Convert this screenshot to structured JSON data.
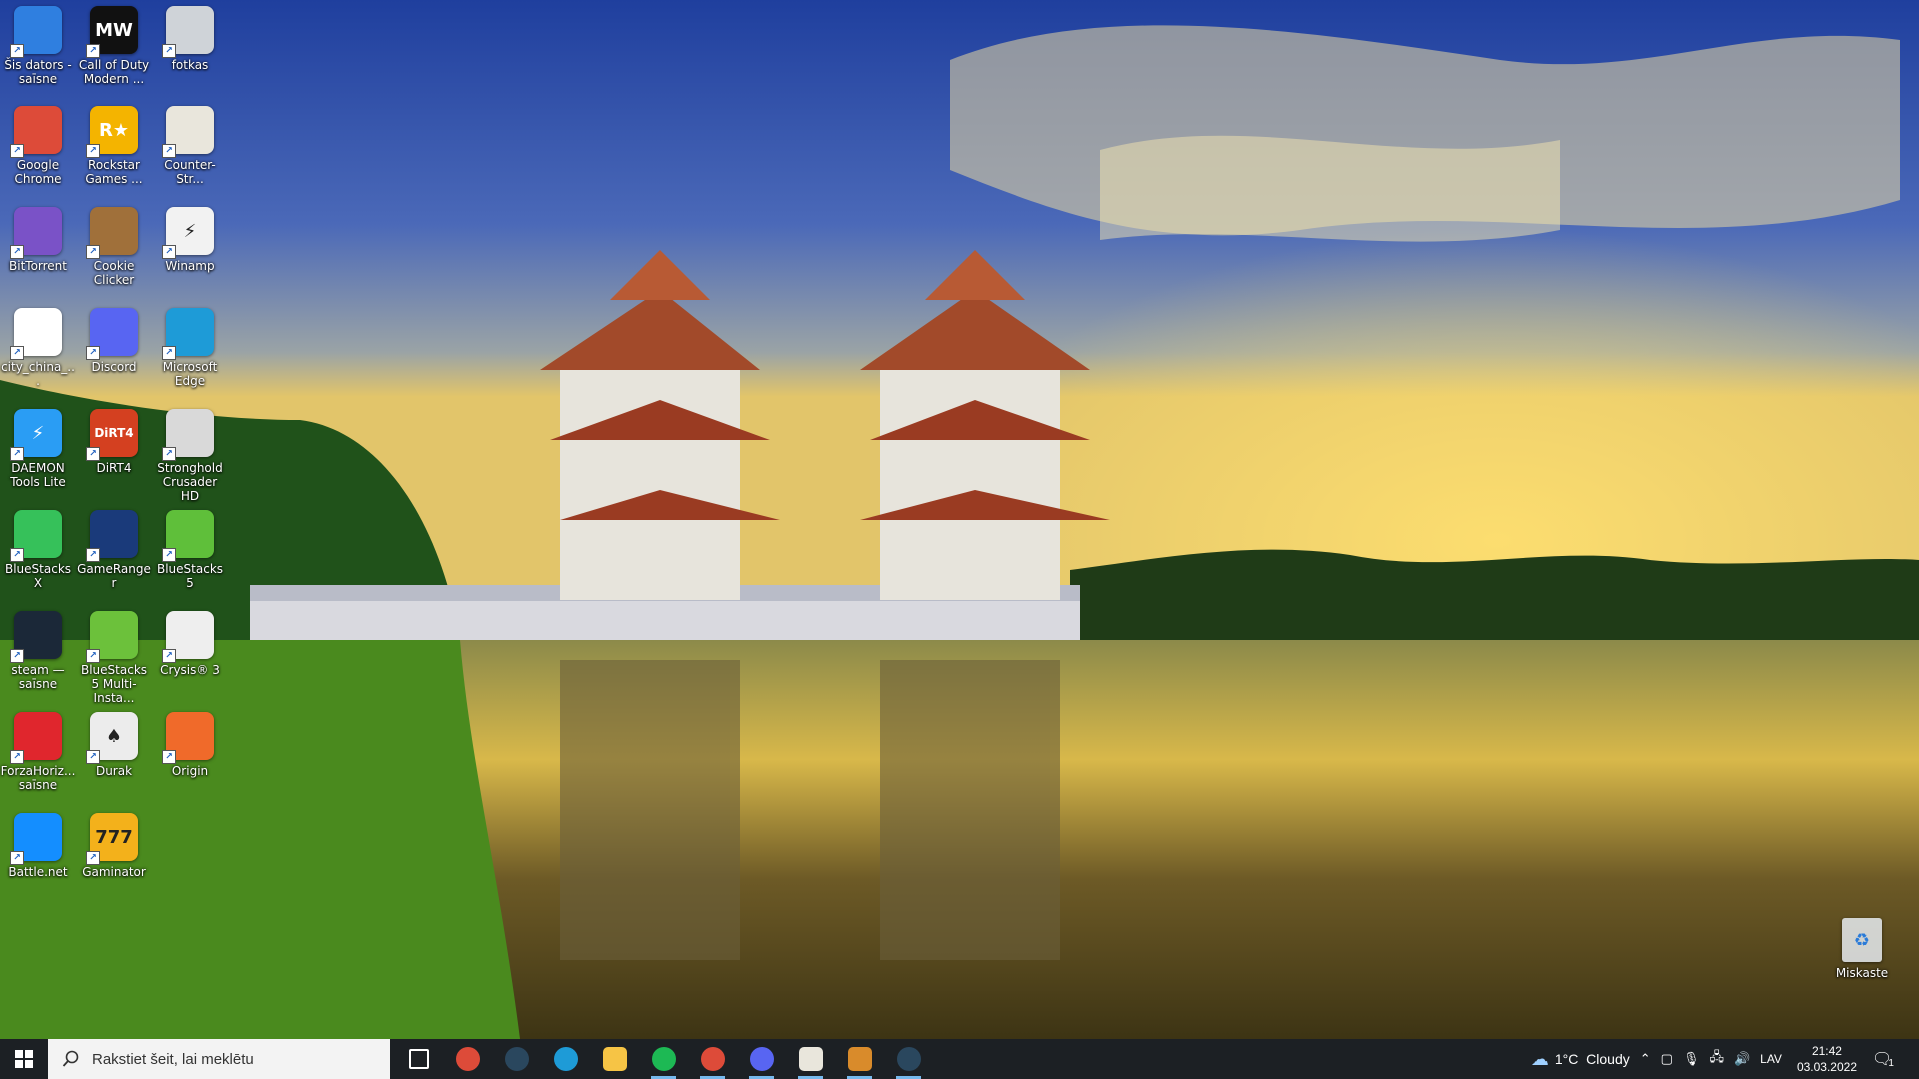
{
  "desktop": {
    "icons": [
      {
        "label": "Šis dators - saīsne",
        "icon": "computer-icon",
        "color": "#2f7fe0"
      },
      {
        "label": "Call of Duty Modern ...",
        "icon": "call-of-duty-icon",
        "color": "#111111",
        "glyph": "MW"
      },
      {
        "label": "fotkas",
        "icon": "camera-icon",
        "color": "#cfd3d8"
      },
      {
        "label": "Google Chrome",
        "icon": "chrome-icon",
        "color": "#dd4b39"
      },
      {
        "label": "Rockstar Games ...",
        "icon": "rockstar-icon",
        "color": "#f4b400",
        "glyph": "R★"
      },
      {
        "label": "Counter-Str...",
        "icon": "counter-strike-icon",
        "color": "#e9e6dc"
      },
      {
        "label": "BitTorrent",
        "icon": "bittorrent-icon",
        "color": "#7a52c7"
      },
      {
        "label": "Cookie Clicker",
        "icon": "cookie-icon",
        "color": "#a0703a"
      },
      {
        "label": "Winamp",
        "icon": "winamp-icon",
        "color": "#f2f2f2",
        "glyph": "⚡"
      },
      {
        "label": "city_china_...",
        "icon": "image-file-icon",
        "color": "#ffffff"
      },
      {
        "label": "Discord",
        "icon": "discord-icon",
        "color": "#5865f2"
      },
      {
        "label": "Microsoft Edge",
        "icon": "edge-icon",
        "color": "#1e9bd7"
      },
      {
        "label": "DAEMON Tools Lite",
        "icon": "daemon-tools-icon",
        "color": "#2a9df4",
        "glyph": "⚡"
      },
      {
        "label": "DiRT4",
        "icon": "dirt4-icon",
        "color": "#d44020",
        "glyph": "DiRT4"
      },
      {
        "label": "Stronghold Crusader HD",
        "icon": "stronghold-icon",
        "color": "#d9d9d9"
      },
      {
        "label": "BlueStacks X",
        "icon": "bluestacks-x-icon",
        "color": "#36c15a"
      },
      {
        "label": "GameRanger",
        "icon": "gameranger-icon",
        "color": "#1a3a7a"
      },
      {
        "label": "BlueStacks 5",
        "icon": "bluestacks-icon",
        "color": "#5fbf3a"
      },
      {
        "label": "steam — saīsne",
        "icon": "steam-icon",
        "color": "#1b2838"
      },
      {
        "label": "BlueStacks 5 Multi-Insta...",
        "icon": "bluestacks-multi-icon",
        "color": "#6cc13b"
      },
      {
        "label": "Crysis® 3",
        "icon": "crysis-icon",
        "color": "#eeeeee"
      },
      {
        "label": "ForzaHoriz... saīsne",
        "icon": "forza-icon",
        "color": "#e0262d"
      },
      {
        "label": "Durak",
        "icon": "durak-icon",
        "color": "#ececec",
        "glyph": "♠"
      },
      {
        "label": "Origin",
        "icon": "origin-icon",
        "color": "#f06a2a"
      },
      {
        "label": "Battle.net",
        "icon": "battlenet-icon",
        "color": "#148eff"
      },
      {
        "label": "Gaminator",
        "icon": "gaminator-icon",
        "color": "#f3b11b",
        "glyph": "777"
      }
    ],
    "recycle_bin": {
      "label": "Miskaste",
      "icon": "recycle-bin-icon"
    }
  },
  "taskbar": {
    "search_placeholder": "Rakstiet šeit, lai meklētu",
    "apps": [
      {
        "name": "task-view",
        "icon": "task-view-icon",
        "color": "#ffffff",
        "running": false
      },
      {
        "name": "chrome",
        "icon": "chrome-icon",
        "color": "#dd4b39",
        "running": false
      },
      {
        "name": "steam",
        "icon": "steam-icon",
        "color": "#2a475e",
        "running": false
      },
      {
        "name": "edge",
        "icon": "edge-icon",
        "color": "#1e9bd7",
        "running": false
      },
      {
        "name": "file-explorer",
        "icon": "folder-icon",
        "color": "#f6c445",
        "running": false
      },
      {
        "name": "spotify",
        "icon": "spotify-icon",
        "color": "#1db954",
        "running": true
      },
      {
        "name": "chrome-2",
        "icon": "chrome-icon",
        "color": "#dd4b39",
        "running": true
      },
      {
        "name": "discord",
        "icon": "discord-icon",
        "color": "#5865f2",
        "running": true
      },
      {
        "name": "counter-strike",
        "icon": "counter-strike-icon",
        "color": "#e9e6dc",
        "running": true
      },
      {
        "name": "counter-strike-2",
        "icon": "counter-strike-icon",
        "color": "#d98b2b",
        "running": true
      },
      {
        "name": "steam-2",
        "icon": "steam-icon",
        "color": "#2a475e",
        "running": true
      }
    ],
    "weather": "1°C  Cloudy",
    "language": "LAV",
    "time": "21:42",
    "date": "03.03.2022",
    "notification_count": "1"
  }
}
